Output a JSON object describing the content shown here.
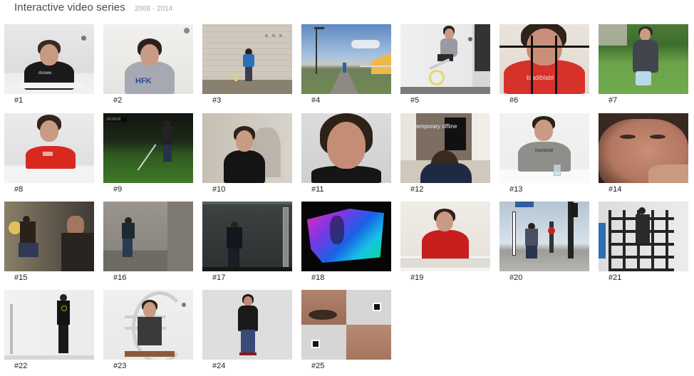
{
  "page": {
    "title": "Interactive video series",
    "years": "2008 - 2014"
  },
  "videos": [
    {
      "label": "#1"
    },
    {
      "label": "#2"
    },
    {
      "label": "#3"
    },
    {
      "label": "#4"
    },
    {
      "label": "#5"
    },
    {
      "label": "#6",
      "shirt_text": "bladiblabl"
    },
    {
      "label": "#7"
    },
    {
      "label": "#8"
    },
    {
      "label": "#9"
    },
    {
      "label": "#10"
    },
    {
      "label": "#11"
    },
    {
      "label": "#12",
      "overlay_text": "temporary offline"
    },
    {
      "label": "#13",
      "shirt_text": "bladiblabl"
    },
    {
      "label": "#14"
    },
    {
      "label": "#15"
    },
    {
      "label": "#16"
    },
    {
      "label": "#17"
    },
    {
      "label": "#18"
    },
    {
      "label": "#19"
    },
    {
      "label": "#20"
    },
    {
      "label": "#21"
    },
    {
      "label": "#22"
    },
    {
      "label": "#23"
    },
    {
      "label": "#24"
    },
    {
      "label": "#25"
    }
  ],
  "colors": {
    "title": "#4a4a4a",
    "years": "#a8a8a8",
    "label": "#222222"
  }
}
